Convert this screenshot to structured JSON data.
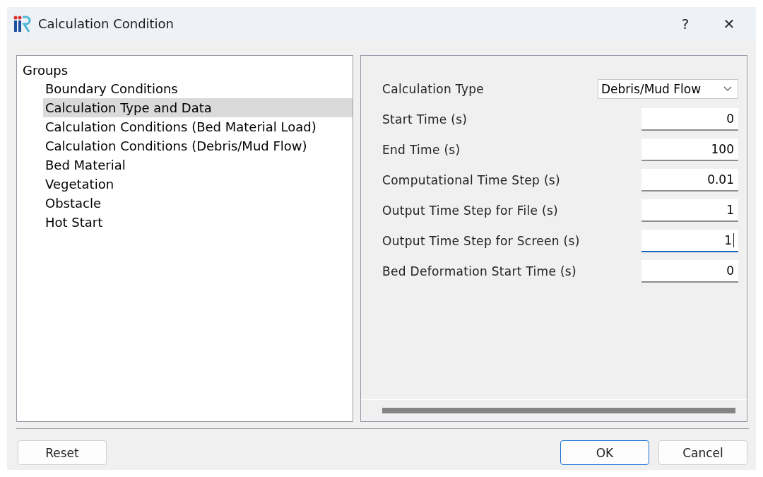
{
  "window": {
    "title": "Calculation Condition",
    "help": "?",
    "close": "✕"
  },
  "groups": {
    "label": "Groups",
    "children": [
      {
        "label": "Boundary Conditions",
        "selected": false
      },
      {
        "label": "Calculation Type and Data",
        "selected": true
      },
      {
        "label": "Calculation Conditions (Bed Material Load)",
        "selected": false
      },
      {
        "label": "Calculation Conditions (Debris/Mud Flow)",
        "selected": false
      },
      {
        "label": "Bed Material",
        "selected": false
      },
      {
        "label": "Vegetation",
        "selected": false
      },
      {
        "label": "Obstacle",
        "selected": false
      },
      {
        "label": "Hot Start",
        "selected": false
      }
    ]
  },
  "settings": [
    {
      "kind": "dropdown",
      "label": "Calculation Type",
      "value": "Debris/Mud Flow"
    },
    {
      "kind": "field",
      "label": "Start Time (s)",
      "value": "0",
      "focused": false
    },
    {
      "kind": "field",
      "label": "End Time (s)",
      "value": "100",
      "focused": false
    },
    {
      "kind": "field",
      "label": "Computational Time Step (s)",
      "value": "0.01",
      "focused": false
    },
    {
      "kind": "field",
      "label": "Output Time Step for File (s)",
      "value": "1",
      "focused": false
    },
    {
      "kind": "field",
      "label": "Output Time Step for Screen (s)",
      "value": "1",
      "focused": true
    },
    {
      "kind": "field",
      "label": "Bed Deformation Start Time (s)",
      "value": "0",
      "focused": false
    }
  ],
  "buttons": [
    {
      "label": "Reset",
      "default": false
    },
    {
      "label": "OK",
      "default": true
    },
    {
      "label": "Cancel",
      "default": false
    }
  ]
}
